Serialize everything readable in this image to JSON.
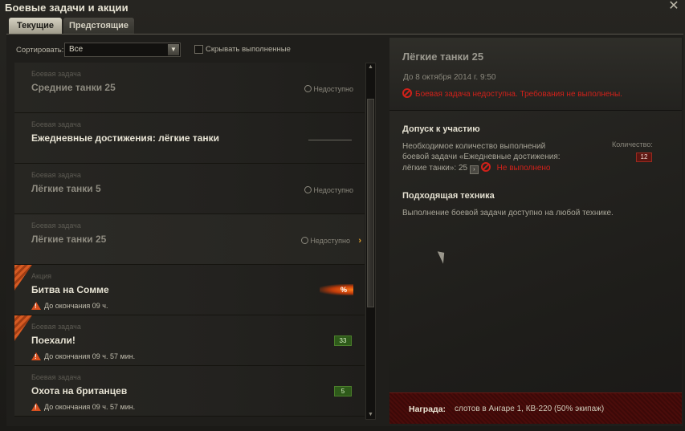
{
  "window": {
    "title": "Боевые задачи и акции"
  },
  "tabs": [
    {
      "label": "Текущие",
      "active": true
    },
    {
      "label": "Предстоящие",
      "active": false
    }
  ],
  "toolbar": {
    "sort_label": "Сортировать:",
    "sort_value": "Все",
    "hide_completed_label": "Скрывать выполненные",
    "hide_completed_checked": false
  },
  "quests": [
    {
      "type": "Боевая задача",
      "name": "Средние танки 25",
      "status": "Недоступно",
      "dim": true
    },
    {
      "type": "Боевая задача",
      "name": "Ежедневные достижения: лёгкие танки",
      "status": "",
      "dim": false
    },
    {
      "type": "Боевая задача",
      "name": "Лёгкие танки 5",
      "status": "Недоступно",
      "dim": true
    },
    {
      "type": "Боевая задача",
      "name": "Лёгкие танки 25",
      "status": "Недоступно",
      "dim": true,
      "selected": true
    },
    {
      "type": "Акция",
      "name": "Битва на Сомме",
      "deadline": "До окончания 09 ч.",
      "badge": "%",
      "new": true
    },
    {
      "type": "Боевая задача",
      "name": "Поехали!",
      "deadline": "До окончания 09 ч. 57 мин.",
      "count": "33",
      "new": true
    },
    {
      "type": "Боевая задача",
      "name": "Охота на британцев",
      "deadline": "До окончания 09 ч. 57 мин.",
      "count": "5"
    }
  ],
  "detail": {
    "title": "Лёгкие танки 25",
    "date": "До 8 октября 2014 г. 9:50",
    "error": "Боевая задача недоступна. Требования не выполнены.",
    "requirements": {
      "title": "Допуск к участию",
      "text_line1": "Необходимое количество выполнений",
      "text_line2": "боевой задачи «Ежедневные достижения:",
      "text_line3_prefix": "лёгкие танки»: 25",
      "not_done": "Не выполнено",
      "quantity_label": "Количество:",
      "quantity_value": "12"
    },
    "vehicles": {
      "title": "Подходящая техника",
      "text": "Выполнение боевой задачи доступно на любой технике."
    },
    "reward": {
      "label": "Награда:",
      "text": "слотов в Ангаре 1, КВ-220 (50% экипаж)"
    }
  },
  "colors": {
    "accent_orange": "#d65a22",
    "error_red": "#d0211a",
    "count_green": "#2e5a1a"
  }
}
